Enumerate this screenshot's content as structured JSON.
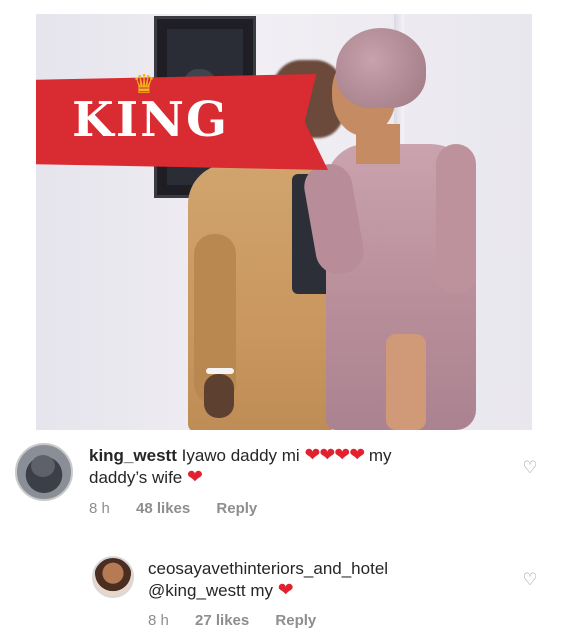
{
  "banner": {
    "text": "KING",
    "crown_icon": "crown-icon"
  },
  "comments": [
    {
      "username": "king_westt",
      "text_before_hearts": "Iyawo daddy mi",
      "hearts": "❤❤❤❤",
      "text_after_hearts": "my",
      "line2_text": "daddy’s wife",
      "line2_heart": "❤",
      "time": "8 h",
      "likes": "48 likes",
      "reply_label": "Reply"
    },
    {
      "username": "ceosayavethinteriors_and_hotel",
      "mention": "@king_westt",
      "text": "my",
      "heart": "❤",
      "time": "8 h",
      "likes": "27 likes",
      "reply_label": "Reply"
    }
  ],
  "colors": {
    "heart": "#e3202d",
    "banner": "#d82b32",
    "crown": "#f2b31e",
    "meta_text": "#8e8e8e"
  }
}
